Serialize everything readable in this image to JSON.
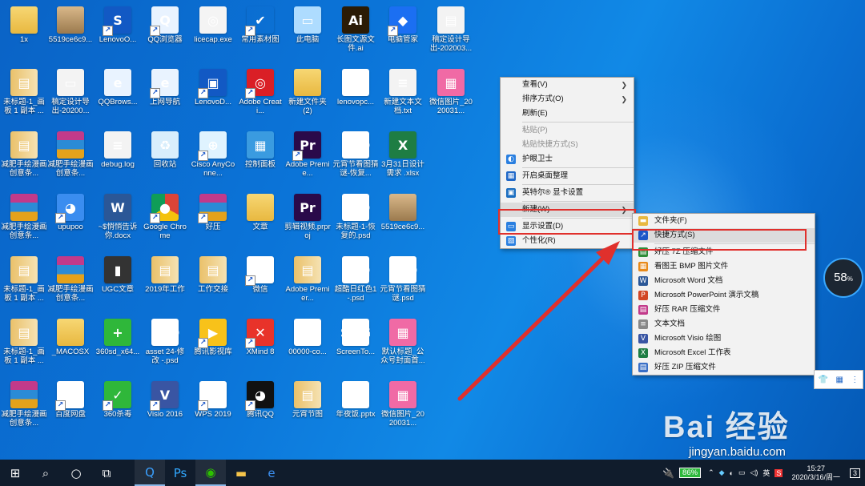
{
  "desktop_icons": [
    {
      "label": "1x",
      "type": "folder",
      "glyph": "",
      "shortcut": false
    },
    {
      "label": "5519ce6c9...",
      "type": "hamster",
      "glyph": "",
      "shortcut": false
    },
    {
      "label": "LenovoO...",
      "type": "lenovo",
      "glyph": "S",
      "shortcut": true
    },
    {
      "label": "QQ浏览器",
      "type": "qq",
      "glyph": "Q",
      "shortcut": true
    },
    {
      "label": "licecap.exe",
      "type": "exe",
      "glyph": "◎",
      "shortcut": false
    },
    {
      "label": "常用素材图",
      "type": "check",
      "glyph": "✔",
      "shortcut": true
    },
    {
      "label": "此电脑",
      "type": "pc",
      "glyph": "▭",
      "shortcut": false
    },
    {
      "label": "长图文源文件.ai",
      "type": "ai",
      "glyph": "Ai",
      "shortcut": false
    },
    {
      "label": "电脑管家",
      "type": "shield",
      "glyph": "◆",
      "shortcut": true
    },
    {
      "label": "稿定设计导出-202003...",
      "type": "doc",
      "glyph": "▤",
      "shortcut": false
    },
    {
      "label": "未标题-1_画板 1 副本 ...",
      "type": "book",
      "glyph": "▤",
      "shortcut": false
    },
    {
      "label": "稿定设计导出-20200...",
      "type": "doc",
      "glyph": "▭",
      "shortcut": false
    },
    {
      "label": "QQBrows...",
      "type": "ie",
      "glyph": "e",
      "shortcut": false
    },
    {
      "label": "上网导航",
      "type": "ie",
      "glyph": "e",
      "shortcut": true
    },
    {
      "label": "LenovoD...",
      "type": "lenovo",
      "glyph": "▣",
      "shortcut": true
    },
    {
      "label": "Adobe Creati...",
      "type": "cc",
      "glyph": "◎",
      "shortcut": true
    },
    {
      "label": "新建文件夹 (2)",
      "type": "folder",
      "glyph": "",
      "shortcut": false
    },
    {
      "label": "lenovopc...",
      "type": "l",
      "glyph": "L",
      "shortcut": false
    },
    {
      "label": "新建文本文档.txt",
      "type": "doc",
      "glyph": "≡",
      "shortcut": false
    },
    {
      "label": "微信图片_2020031...",
      "type": "wechatimg",
      "glyph": "▦",
      "shortcut": false
    },
    {
      "label": "减肥手绘漫画创意条...",
      "type": "book",
      "glyph": "▤",
      "shortcut": false
    },
    {
      "label": "减肥手绘漫画创意条...",
      "type": "rar",
      "glyph": "",
      "shortcut": false
    },
    {
      "label": "debug.log",
      "type": "doc",
      "glyph": "≡",
      "shortcut": false
    },
    {
      "label": "回收站",
      "type": "recycle",
      "glyph": "♻",
      "shortcut": false
    },
    {
      "label": "Cisco AnyConne...",
      "type": "cisco",
      "glyph": "⊕",
      "shortcut": true
    },
    {
      "label": "控制面板",
      "type": "panel",
      "glyph": "▦",
      "shortcut": false
    },
    {
      "label": "Adobe Premie...",
      "type": "pr",
      "glyph": "Pr",
      "shortcut": true
    },
    {
      "label": "元宵节看图猜谜-恢复...",
      "type": "psd",
      "glyph": "PSD",
      "shortcut": false
    },
    {
      "label": "3月31日设计需求 .xlsx",
      "type": "xlsx",
      "glyph": "X",
      "shortcut": false
    },
    {
      "label": "",
      "type": "none",
      "glyph": "",
      "shortcut": false
    },
    {
      "label": "减肥手绘漫画创意条...",
      "type": "rar",
      "glyph": "",
      "shortcut": false
    },
    {
      "label": "upupoo",
      "type": "upupoo",
      "glyph": "◕",
      "shortcut": true
    },
    {
      "label": "~$悄悄告诉你.docx",
      "type": "word",
      "glyph": "W",
      "shortcut": false
    },
    {
      "label": "Google Chrome",
      "type": "chrome",
      "glyph": "●",
      "shortcut": true
    },
    {
      "label": "好压",
      "type": "rar",
      "glyph": "",
      "shortcut": true
    },
    {
      "label": "文章",
      "type": "folder",
      "glyph": "",
      "shortcut": false
    },
    {
      "label": "剪辑视频.prproj",
      "type": "pr",
      "glyph": "Pr",
      "shortcut": false
    },
    {
      "label": "未标题-1-恢复的.psd",
      "type": "psd",
      "glyph": "PSD",
      "shortcut": false
    },
    {
      "label": "5519ce6c9...",
      "type": "hamster",
      "glyph": "",
      "shortcut": false
    },
    {
      "label": "",
      "type": "none",
      "glyph": "",
      "shortcut": false
    },
    {
      "label": "未标题-1_画板 1 副本 ...",
      "type": "book",
      "glyph": "▤",
      "shortcut": false
    },
    {
      "label": "减肥手绘漫画创意条...",
      "type": "rar",
      "glyph": "",
      "shortcut": false
    },
    {
      "label": "UGC文章",
      "type": "ugc",
      "glyph": "▮",
      "shortcut": false
    },
    {
      "label": "2019年工作",
      "type": "book",
      "glyph": "▤",
      "shortcut": false
    },
    {
      "label": "工作交接",
      "type": "book",
      "glyph": "▤",
      "shortcut": false
    },
    {
      "label": "微信",
      "type": "wechat",
      "glyph": "◉",
      "shortcut": true
    },
    {
      "label": "Adobe Premier...",
      "type": "book",
      "glyph": "▤",
      "shortcut": false
    },
    {
      "label": "超酷日红色1-.psd",
      "type": "psd",
      "glyph": "PSD",
      "shortcut": false
    },
    {
      "label": "元宵节看图猜谜.psd",
      "type": "psd",
      "glyph": "PSD",
      "shortcut": false
    },
    {
      "label": "",
      "type": "none",
      "glyph": "",
      "shortcut": false
    },
    {
      "label": "未标题-1_画板 1 副本 ...",
      "type": "book",
      "glyph": "▤",
      "shortcut": false
    },
    {
      "label": "_MACOSX",
      "type": "folder",
      "glyph": "",
      "shortcut": false
    },
    {
      "label": "360sd_x64...",
      "type": "360",
      "glyph": "+",
      "shortcut": false
    },
    {
      "label": "asset 24-修改 -.psd",
      "type": "psd",
      "glyph": "PSD",
      "shortcut": false
    },
    {
      "label": "腾讯影视库",
      "type": "video",
      "glyph": "▶",
      "shortcut": true
    },
    {
      "label": "XMind 8",
      "type": "xmind",
      "glyph": "✕",
      "shortcut": true
    },
    {
      "label": "00000-co...",
      "type": "pdf",
      "glyph": "PDF",
      "shortcut": false
    },
    {
      "label": "ScreenTo...",
      "type": "screen",
      "glyph": "S>G",
      "shortcut": false
    },
    {
      "label": "默认标题_公众号封面首...",
      "type": "wechatimg",
      "glyph": "▦",
      "shortcut": false
    },
    {
      "label": "",
      "type": "none",
      "glyph": "",
      "shortcut": false
    },
    {
      "label": "减肥手绘漫画创意条...",
      "type": "rar",
      "glyph": "",
      "shortcut": false
    },
    {
      "label": "百度网盘",
      "type": "baidu",
      "glyph": "☁",
      "shortcut": true
    },
    {
      "label": "360杀毒",
      "type": "360",
      "glyph": "✓",
      "shortcut": true
    },
    {
      "label": "Visio 2016",
      "type": "visio",
      "glyph": "V",
      "shortcut": true
    },
    {
      "label": "WPS 2019",
      "type": "wps",
      "glyph": "W",
      "shortcut": true
    },
    {
      "label": "腾讯QQ",
      "type": "penguin",
      "glyph": "◕",
      "shortcut": true
    },
    {
      "label": "元宵节图",
      "type": "book",
      "glyph": "▤",
      "shortcut": false
    },
    {
      "label": "年夜饭.pptx",
      "type": "ppt",
      "glyph": "P",
      "shortcut": false
    },
    {
      "label": "微信图片_2020031...",
      "type": "wechatimg",
      "glyph": "▦",
      "shortcut": false
    },
    {
      "label": "",
      "type": "none",
      "glyph": "",
      "shortcut": false
    }
  ],
  "context_menu": {
    "items": [
      {
        "label": "查看(V)",
        "submenu": true,
        "disabled": false,
        "icon": "",
        "icon_color": ""
      },
      {
        "label": "排序方式(O)",
        "submenu": true,
        "disabled": false,
        "icon": "",
        "icon_color": ""
      },
      {
        "label": "刷新(E)",
        "submenu": false,
        "disabled": false,
        "icon": "",
        "icon_color": ""
      },
      {
        "sep": true
      },
      {
        "label": "粘贴(P)",
        "submenu": false,
        "disabled": true,
        "icon": "",
        "icon_color": ""
      },
      {
        "label": "粘贴快捷方式(S)",
        "submenu": false,
        "disabled": true,
        "icon": "",
        "icon_color": ""
      },
      {
        "label": "护眼卫士",
        "submenu": false,
        "disabled": false,
        "icon": "◐",
        "icon_color": "#2a7fe0"
      },
      {
        "sep": true
      },
      {
        "label": "开启桌面整理",
        "submenu": false,
        "disabled": false,
        "icon": "▦",
        "icon_color": "#2068c8"
      },
      {
        "sep": true
      },
      {
        "label": "英特尔® 显卡设置",
        "submenu": false,
        "disabled": false,
        "icon": "▣",
        "icon_color": "#1a6dc0"
      },
      {
        "sep": true
      },
      {
        "label": "新建(W)",
        "submenu": true,
        "disabled": false,
        "icon": "",
        "icon_color": "",
        "highlight": true
      },
      {
        "sep": true
      },
      {
        "label": "显示设置(D)",
        "submenu": false,
        "disabled": false,
        "icon": "▭",
        "icon_color": "#2a7fe0"
      },
      {
        "label": "个性化(R)",
        "submenu": false,
        "disabled": false,
        "icon": "▨",
        "icon_color": "#2a7fe0"
      }
    ]
  },
  "new_submenu": {
    "items": [
      {
        "label": "文件夹(F)",
        "icon": "▬",
        "icon_color": "#e8b840"
      },
      {
        "label": "快捷方式(S)",
        "icon": "↗",
        "icon_color": "#1a56c8",
        "highlight": true
      },
      {
        "sep": true
      },
      {
        "label": "好压 7Z 压缩文件",
        "icon": "▤",
        "icon_color": "#2f8d3a"
      },
      {
        "label": "看图王 BMP 图片文件",
        "icon": "▦",
        "icon_color": "#e88a1a"
      },
      {
        "label": "Microsoft Word 文档",
        "icon": "W",
        "icon_color": "#2b5797"
      },
      {
        "label": "Microsoft PowerPoint 演示文稿",
        "icon": "P",
        "icon_color": "#d24726"
      },
      {
        "label": "好压 RAR 压缩文件",
        "icon": "▤",
        "icon_color": "#c23a8a"
      },
      {
        "label": "文本文档",
        "icon": "≡",
        "icon_color": "#888888"
      },
      {
        "label": "Microsoft Visio 绘图",
        "icon": "V",
        "icon_color": "#3955a3"
      },
      {
        "label": "Microsoft Excel 工作表",
        "icon": "X",
        "icon_color": "#1e7d43"
      },
      {
        "label": "好压 ZIP 压缩文件",
        "icon": "▤",
        "icon_color": "#3a6fc6"
      }
    ]
  },
  "taskbar": {
    "start_icon": "⊞",
    "search_icon": "⌕",
    "cortana_icon": "○",
    "taskview_icon": "⧉",
    "apps": [
      {
        "name": "qq-browser",
        "glyph": "Q",
        "color": "#3aa0ff",
        "active": true
      },
      {
        "name": "photoshop",
        "glyph": "Ps",
        "color": "#31a8ff",
        "active": false
      },
      {
        "name": "wechat",
        "glyph": "◉",
        "color": "#2dc100",
        "active": true
      },
      {
        "name": "file-explorer",
        "glyph": "▬",
        "color": "#f5c44a",
        "active": false
      },
      {
        "name": "edge",
        "glyph": "e",
        "color": "#3c8ff0",
        "active": false
      }
    ],
    "battery": "86%",
    "time": "15:27",
    "date": "2020/3/16/周一",
    "notification_count": "3"
  },
  "perf_gauge": {
    "value": "58",
    "unit": "%"
  },
  "watermark": {
    "text": "Bai 经验",
    "url": "jingyan.baidu.com"
  },
  "colors": {
    "annotation": "#e0302c",
    "desktop": "#0b74d8"
  }
}
